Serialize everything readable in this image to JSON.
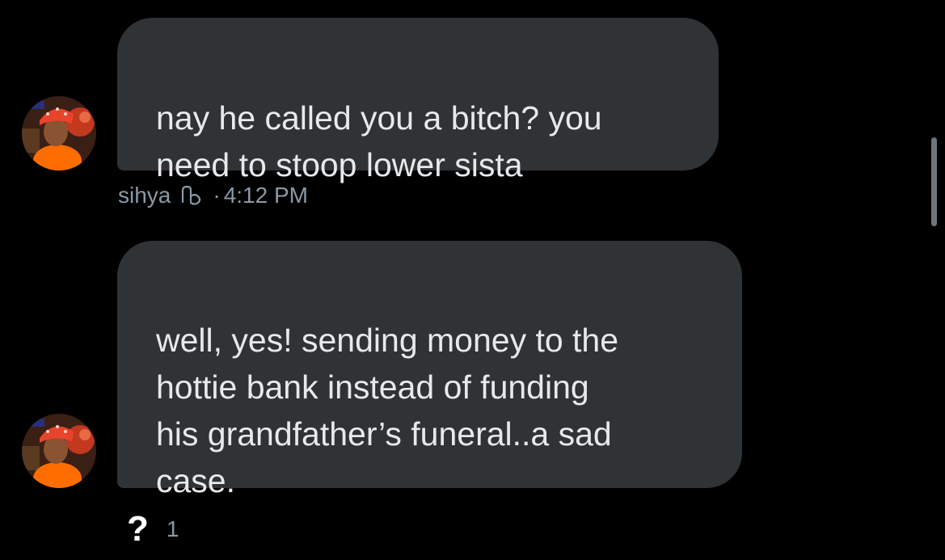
{
  "messages": [
    {
      "text": "nay he called you a bitch? you\nneed to stoop lower sista",
      "sender": "sihya",
      "time": "4:12 PM",
      "seen_icon": "seen-check-icon"
    },
    {
      "text": "well, yes! sending money to the\nhottie bank instead of funding\nhis grandfather’s funeral..a sad\ncase."
    }
  ],
  "reaction": {
    "emoji": "?",
    "count": "1"
  },
  "meta_separator": "·",
  "colors": {
    "background": "#000000",
    "bubble": "#2f3336",
    "text": "#e7e9ea",
    "muted": "#8b98a5"
  }
}
